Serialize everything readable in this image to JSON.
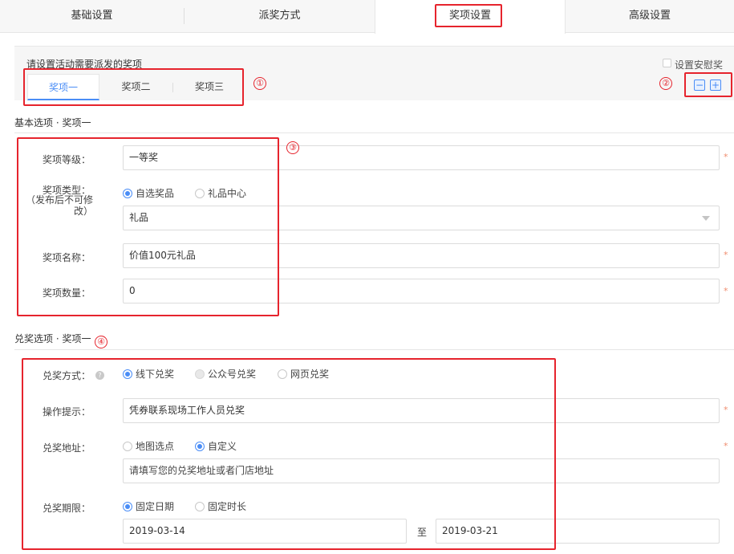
{
  "top_tabs": [
    "基础设置",
    "派奖方式",
    "奖项设置",
    "高级设置"
  ],
  "prize_area": {
    "hint": "请设置活动需要派发的奖项",
    "consolation_label": "设置安慰奖",
    "sub_tabs": [
      "奖项一",
      "奖项二",
      "奖项三"
    ],
    "minus": "−",
    "plus": "+"
  },
  "annotations": [
    "①",
    "②",
    "③",
    "④"
  ],
  "basic": {
    "title": "基本选项 · 奖项一",
    "level_label": "奖项等级：",
    "level_value": "一等奖",
    "type_label": "奖项类型：",
    "type_note": "（发布后不可修改）",
    "type_options": [
      "自选奖品",
      "礼品中心"
    ],
    "type_selected": "自选奖品",
    "type_select_value": "礼品",
    "name_label": "奖项名称：",
    "name_value": "价值100元礼品",
    "qty_label": "奖项数量：",
    "qty_value": "0"
  },
  "redeem": {
    "title": "兑奖选项 · 奖项一",
    "method_label": "兑奖方式：",
    "method_options": [
      "线下兑奖",
      "公众号兑奖",
      "网页兑奖"
    ],
    "method_selected": "线下兑奖",
    "tip_label": "操作提示：",
    "tip_value": "凭券联系现场工作人员兑奖",
    "address_label": "兑奖地址：",
    "address_options": [
      "地图选点",
      "自定义"
    ],
    "address_selected": "自定义",
    "address_placeholder": "请填写您的兑奖地址或者门店地址",
    "period_label": "兑奖期限：",
    "period_options": [
      "固定日期",
      "固定时长"
    ],
    "period_selected": "固定日期",
    "date_start": "2019-03-14",
    "date_to": "至",
    "date_end": "2019-03-21"
  },
  "star": "*",
  "help_icon": "?",
  "colors": {
    "accent": "#4a8df6",
    "annotation_red": "#e6242d",
    "required": "#f08c6e"
  }
}
